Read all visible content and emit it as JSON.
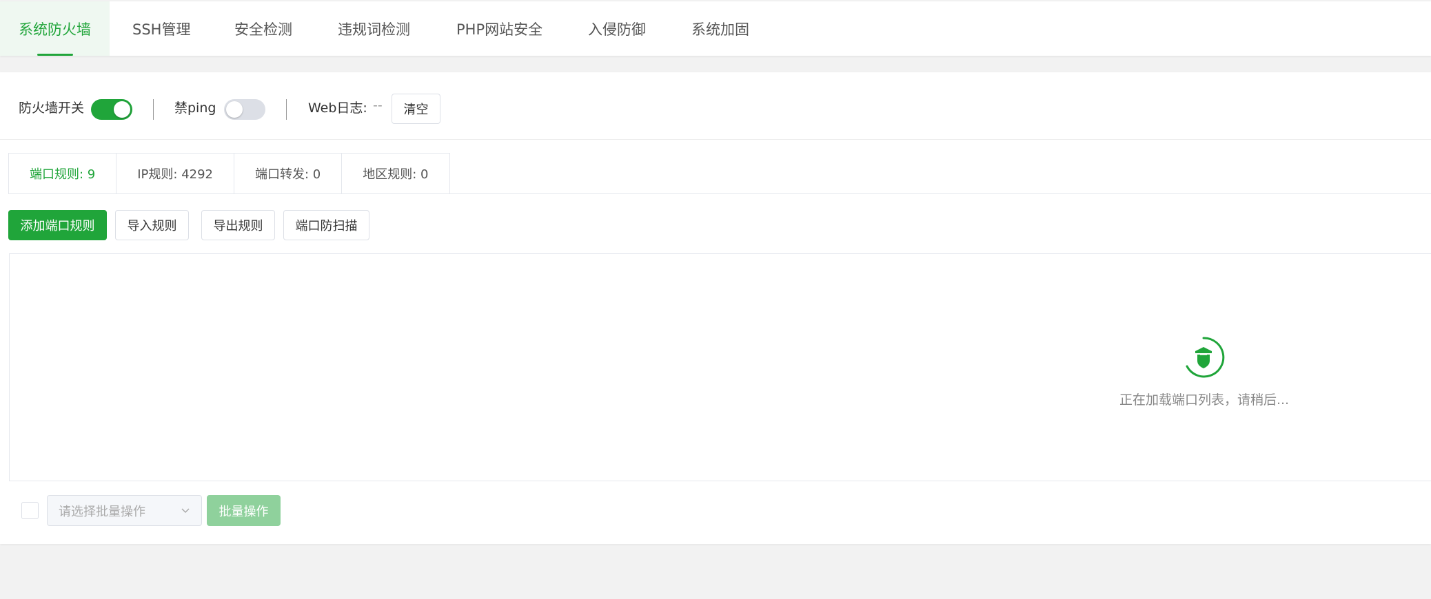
{
  "top_tabs": [
    {
      "label": "系统防火墙",
      "active": true
    },
    {
      "label": "SSH管理",
      "active": false
    },
    {
      "label": "安全检测",
      "active": false
    },
    {
      "label": "违规词检测",
      "active": false
    },
    {
      "label": "PHP网站安全",
      "active": false
    },
    {
      "label": "入侵防御",
      "active": false
    },
    {
      "label": "系统加固",
      "active": false
    }
  ],
  "status": {
    "firewall_label": "防火墙开关",
    "firewall_on": true,
    "ping_label": "禁ping",
    "ping_on": false,
    "weblog_label": "Web日志:",
    "weblog_value": "--",
    "clear_label": "清空"
  },
  "sub_tabs": [
    {
      "label": "端口规则: 9",
      "active": true
    },
    {
      "label": "IP规则: 4292",
      "active": false
    },
    {
      "label": "端口转发: 0",
      "active": false
    },
    {
      "label": "地区规则: 0",
      "active": false
    }
  ],
  "toolbar": {
    "add_label": "添加端口规则",
    "import_label": "导入规则",
    "export_label": "导出规则",
    "scan_label": "端口防扫描"
  },
  "loading": {
    "text": "正在加载端口列表，请稍后..."
  },
  "footer": {
    "select_placeholder": "请选择批量操作",
    "batch_label": "批量操作"
  },
  "colors": {
    "accent": "#20a53a",
    "accent_light": "#eff8f1",
    "accent_disabled": "#8fd19c"
  }
}
